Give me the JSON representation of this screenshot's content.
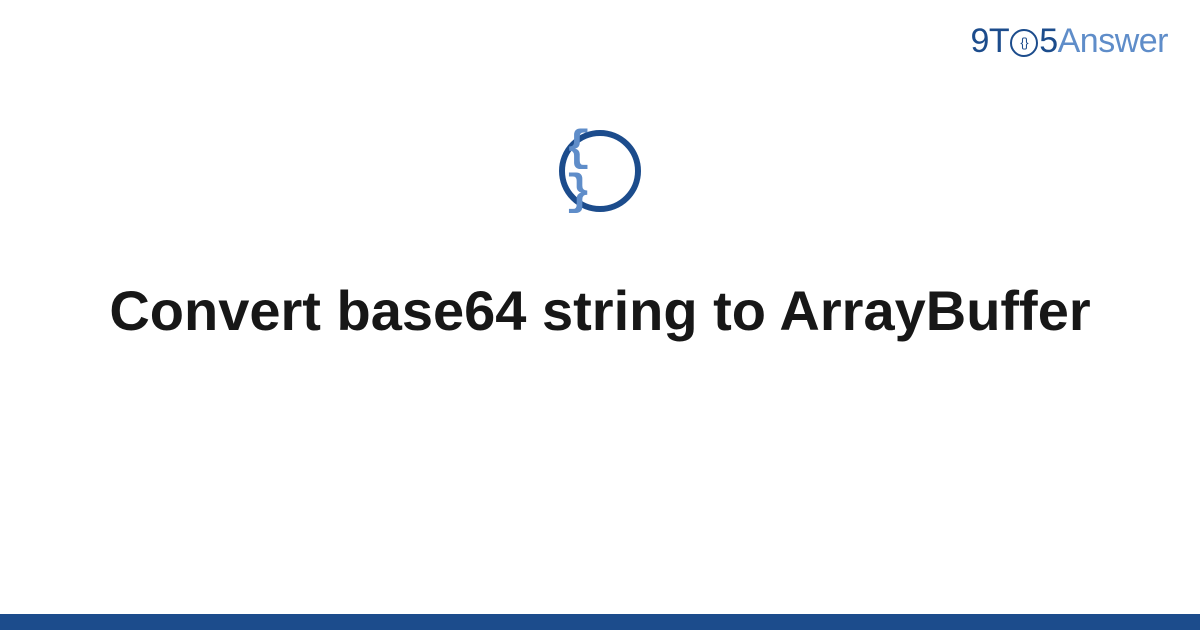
{
  "logo": {
    "prefix": "9T",
    "clock_inner": "{}",
    "five": "5",
    "suffix": "Answer"
  },
  "icon": {
    "name": "braces-icon",
    "glyph": "{ }"
  },
  "title": "Convert base64 string to ArrayBuffer",
  "colors": {
    "dark_blue": "#1c4c8c",
    "light_blue": "#5f8dc9",
    "text": "#171717"
  }
}
